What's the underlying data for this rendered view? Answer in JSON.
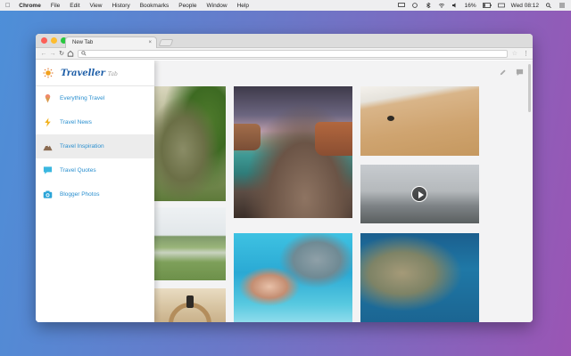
{
  "menubar": {
    "app_name": "Chrome",
    "menus": [
      "File",
      "Edit",
      "View",
      "History",
      "Bookmarks",
      "People",
      "Window",
      "Help"
    ],
    "battery": "16%",
    "clock": "Wed 08:12"
  },
  "browser": {
    "tab_title": "New Tab",
    "tab_close": "×",
    "address_value": ""
  },
  "sidebar": {
    "brand_name": "Traveller",
    "brand_sub": "Tab",
    "items": [
      {
        "label": "Everything Travel",
        "icon": "ice-cream-icon",
        "active": false
      },
      {
        "label": "Travel News",
        "icon": "lightning-icon",
        "active": false
      },
      {
        "label": "Travel Inspiration",
        "icon": "mountain-icon",
        "active": true
      },
      {
        "label": "Travel Quotes",
        "icon": "speech-bubble-icon",
        "active": false
      },
      {
        "label": "Blogger Photos",
        "icon": "camera-icon",
        "active": false
      }
    ]
  },
  "page_actions": {
    "edit_icon": "pencil-icon",
    "comment_icon": "comment-icon"
  },
  "colors": {
    "accent": "#2a8fcf",
    "brand": "#1f5fa8",
    "active_item_bg": "#ececec"
  }
}
